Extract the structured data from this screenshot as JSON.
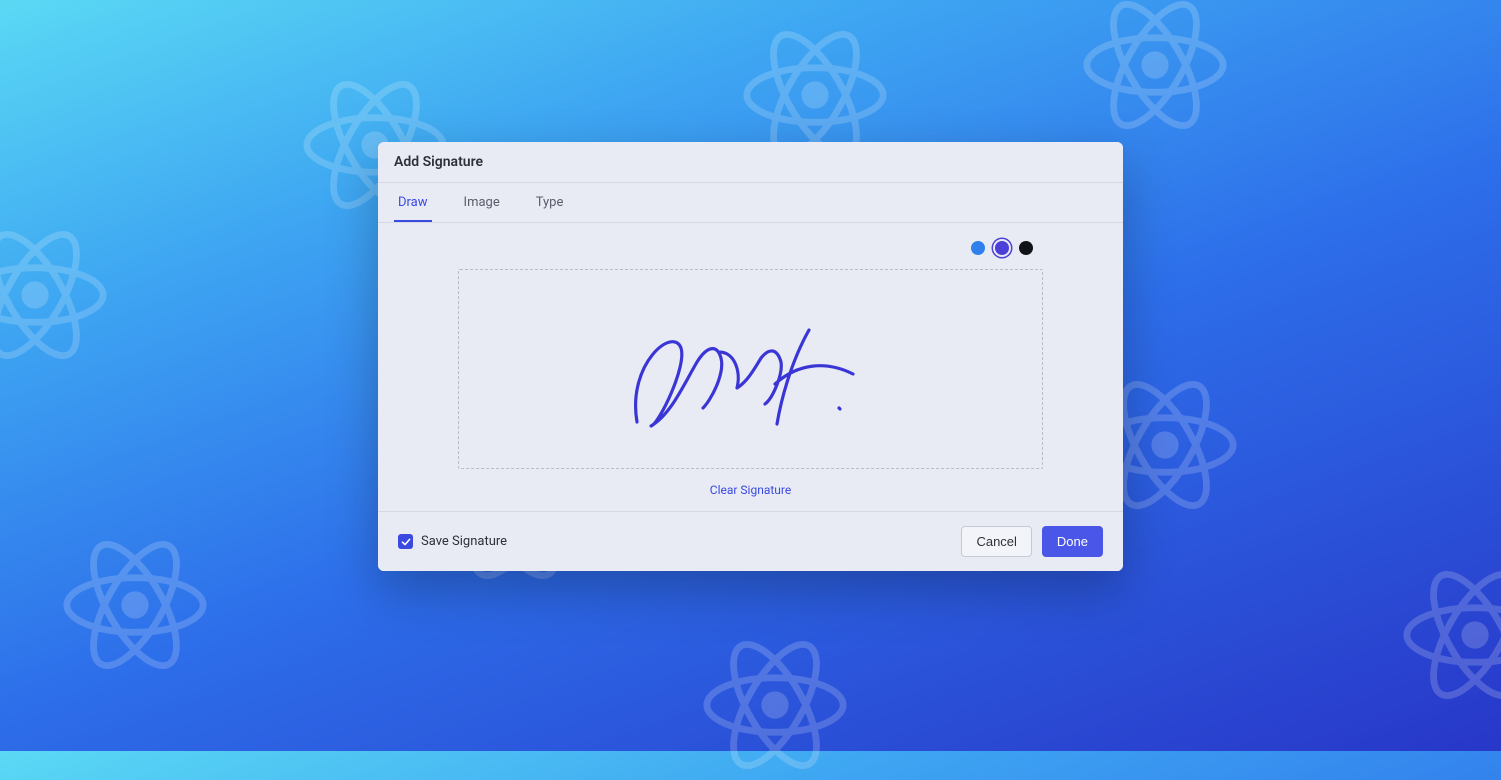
{
  "dialog": {
    "title": "Add Signature",
    "tabs": [
      {
        "label": "Draw",
        "active": true
      },
      {
        "label": "Image",
        "active": false
      },
      {
        "label": "Type",
        "active": false
      }
    ],
    "colors": [
      {
        "name": "blue",
        "hex": "#2F80ED",
        "selected": false
      },
      {
        "name": "indigo",
        "hex": "#4A3FD6",
        "selected": true
      },
      {
        "name": "black",
        "hex": "#111318",
        "selected": false
      }
    ],
    "signature_color": "#3a36d6",
    "clear_label": "Clear Signature",
    "save_checkbox": {
      "label": "Save Signature",
      "checked": true
    },
    "cancel_label": "Cancel",
    "done_label": "Done"
  }
}
